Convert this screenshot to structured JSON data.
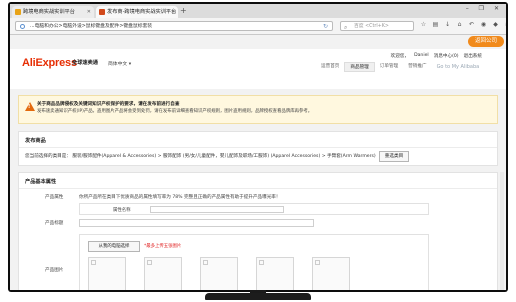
{
  "browser": {
    "tabs": [
      {
        "title": "跨境电商实战实训平台"
      },
      {
        "title": "发布商-跨境电商实战实训平台"
      }
    ],
    "new_tab": "+",
    "window_controls": "– ❐ ✕",
    "address": "...电脑和办公>电脑外设>鼠标键盘及配件>键盘鼠标套装",
    "search_placeholder": "百度 <Ctrl+K>"
  },
  "page": {
    "back_button": "返回公司",
    "header": {
      "logo": "AliExpress",
      "logo_suffix": "全球速卖通",
      "language": "简体中文 ▾",
      "top_links": [
        "欢迎您，",
        "Daniel",
        "消息中心(0)",
        "退出系统"
      ],
      "nav": [
        {
          "label": "运营首页",
          "active": false
        },
        {
          "label": "商品管理",
          "active": true
        },
        {
          "label": "订单管理",
          "active": false
        },
        {
          "label": "营销推广",
          "active": false
        },
        {
          "label": "Go to My Alibaba",
          "active": false
        }
      ]
    },
    "notice": {
      "title": "关于商品品牌侵权及关键词知识产权保护的要求，请在发布前进行自查",
      "text": "发布速卖通知识产权(IP)产品，盗用图片产品将会受到处罚，请在发布前详细查看知识产权规则，图片盗用规则，品牌授权查看品牌库再参考。"
    },
    "publish": {
      "title": "发布商品",
      "category": "您当前选择的类目是：  服装/服饰配件(Apparel & Accessories) > 服饰配饰 (男/女/儿童配件，婴儿配饰及职场/工服饰) (Apparel Accessories) > 手臂套(Arm Warmers)",
      "change_button": "重选类目"
    },
    "basic": {
      "title": "产品基本属性",
      "attr_label": "产品属性",
      "hint": "你所产品所在类目下优质商品的属性填写率为 78% 完整且正确的产品属性有助于提升产品曝光率！",
      "attr_name_label": "属性名称",
      "product_title_label": "产品标题",
      "image_label": "产品图片",
      "upload_button": "从我的电脑选择",
      "upload_tip": "*最多上传五张图片"
    }
  }
}
